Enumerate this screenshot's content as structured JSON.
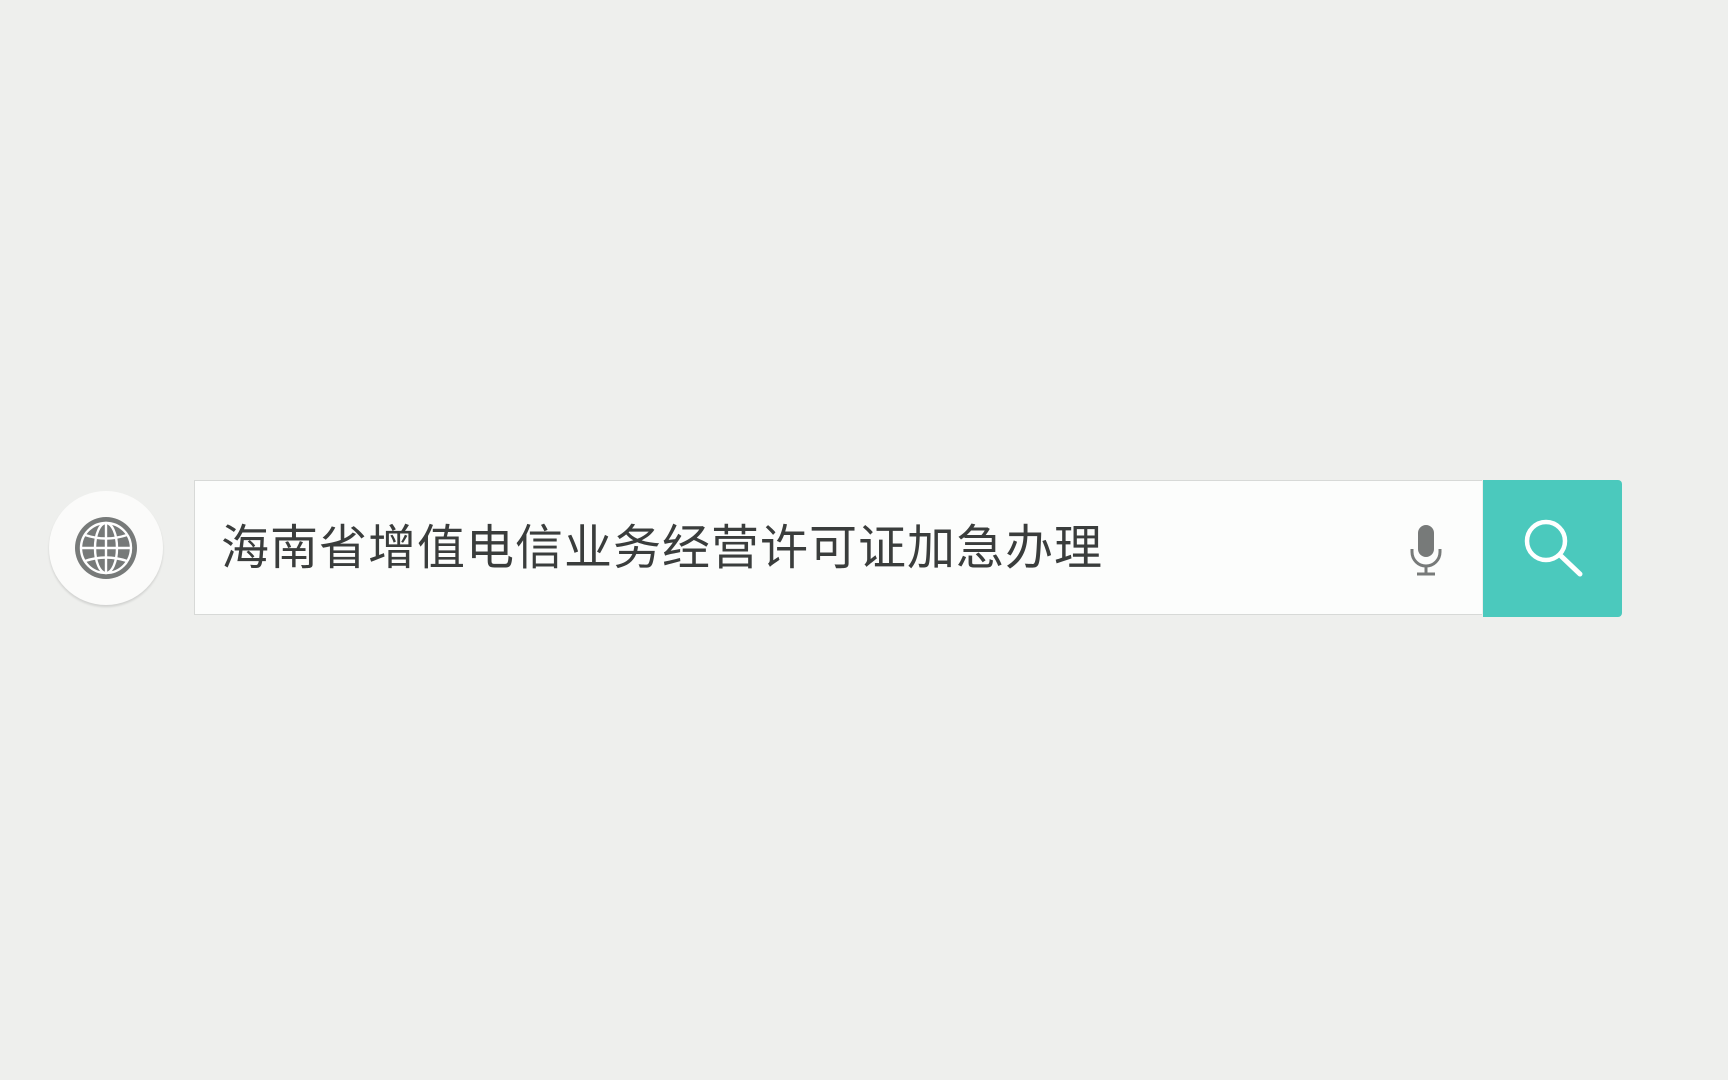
{
  "search": {
    "query": "海南省增值电信业务经营许可证加急办理"
  },
  "icons": {
    "left": "globe-icon",
    "voice": "microphone-icon",
    "submit": "search-icon"
  },
  "colors": {
    "background": "#eeefed",
    "search_field": "#fcfdfc",
    "accent": "#4bc9bd",
    "text": "#3a3d3c",
    "icon_gray": "#777a79"
  }
}
